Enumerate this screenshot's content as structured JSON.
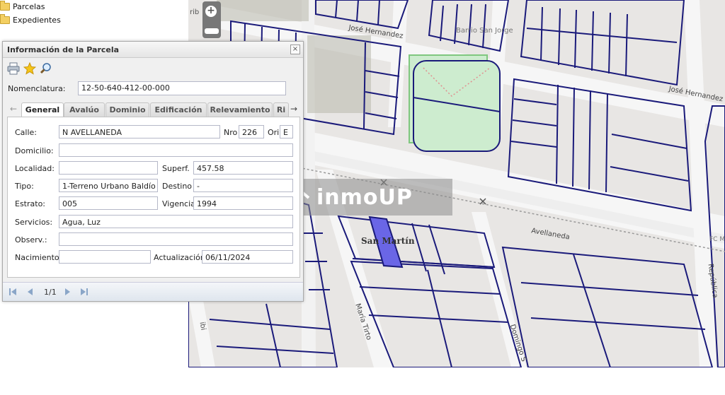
{
  "tree": {
    "items": [
      {
        "label": "Parcelas",
        "icon": "folder-icon"
      },
      {
        "label": "Expedientes",
        "icon": "folder-icon"
      }
    ]
  },
  "map": {
    "streets": {
      "jose_hernandez_1": "José Hernandez",
      "jose_hernandez_2": "José Hernandez",
      "avellaneda": "Avellaneda",
      "san_martin": "San Martín",
      "maria_tirto": "María Tirto",
      "domingo": "Domingo S",
      "republica": "República",
      "barrio": "Barrio San Jorge",
      "fc": "FC Ma",
      "ibi": "ibi",
      "rib": "rib"
    },
    "colors": {
      "parcel_line": "#1a1a7a",
      "highlight": "#6a66e6",
      "plaza": "#cdeccf"
    },
    "watermark": "inmoUP"
  },
  "dialog": {
    "title": "Información de la Parcela",
    "close_label": "×",
    "toolbar": [
      "print-icon",
      "star-icon",
      "search-icon"
    ],
    "nomenclatura_label": "Nomenclatura:",
    "nomenclatura_value": "12-50-640-412-00-000",
    "tabs": [
      "General",
      "Avalúo",
      "Dominio",
      "Edificación",
      "Relevamiento",
      "Ri"
    ],
    "active_tab": "General",
    "form": {
      "calle_label": "Calle:",
      "calle_value": "N AVELLANEDA",
      "nro_label": "Nro",
      "nro_value": "226",
      "ori_label": "Ori",
      "ori_value": "E",
      "domicilio_label": "Domicilio:",
      "domicilio_value": "",
      "localidad_label": "Localidad:",
      "localidad_value": "",
      "superf_label": "Superf.",
      "superf_value": "457.58",
      "tipo_label": "Tipo:",
      "tipo_value": "1-Terreno Urbano Baldío",
      "destino_label": "Destino",
      "destino_value": "-",
      "estrato_label": "Estrato:",
      "estrato_value": "005",
      "vigencia_label": "Vigencia",
      "vigencia_value": "1994",
      "servicios_label": "Servicios:",
      "servicios_value": "Agua, Luz",
      "observ_label": "Observ.:",
      "observ_value": "",
      "nacimiento_label": "Nacimiento:",
      "nacimiento_value": "",
      "actualizacion_label": "Actualización",
      "actualizacion_value": "06/11/2024"
    },
    "pager": {
      "text": "1/1"
    }
  }
}
